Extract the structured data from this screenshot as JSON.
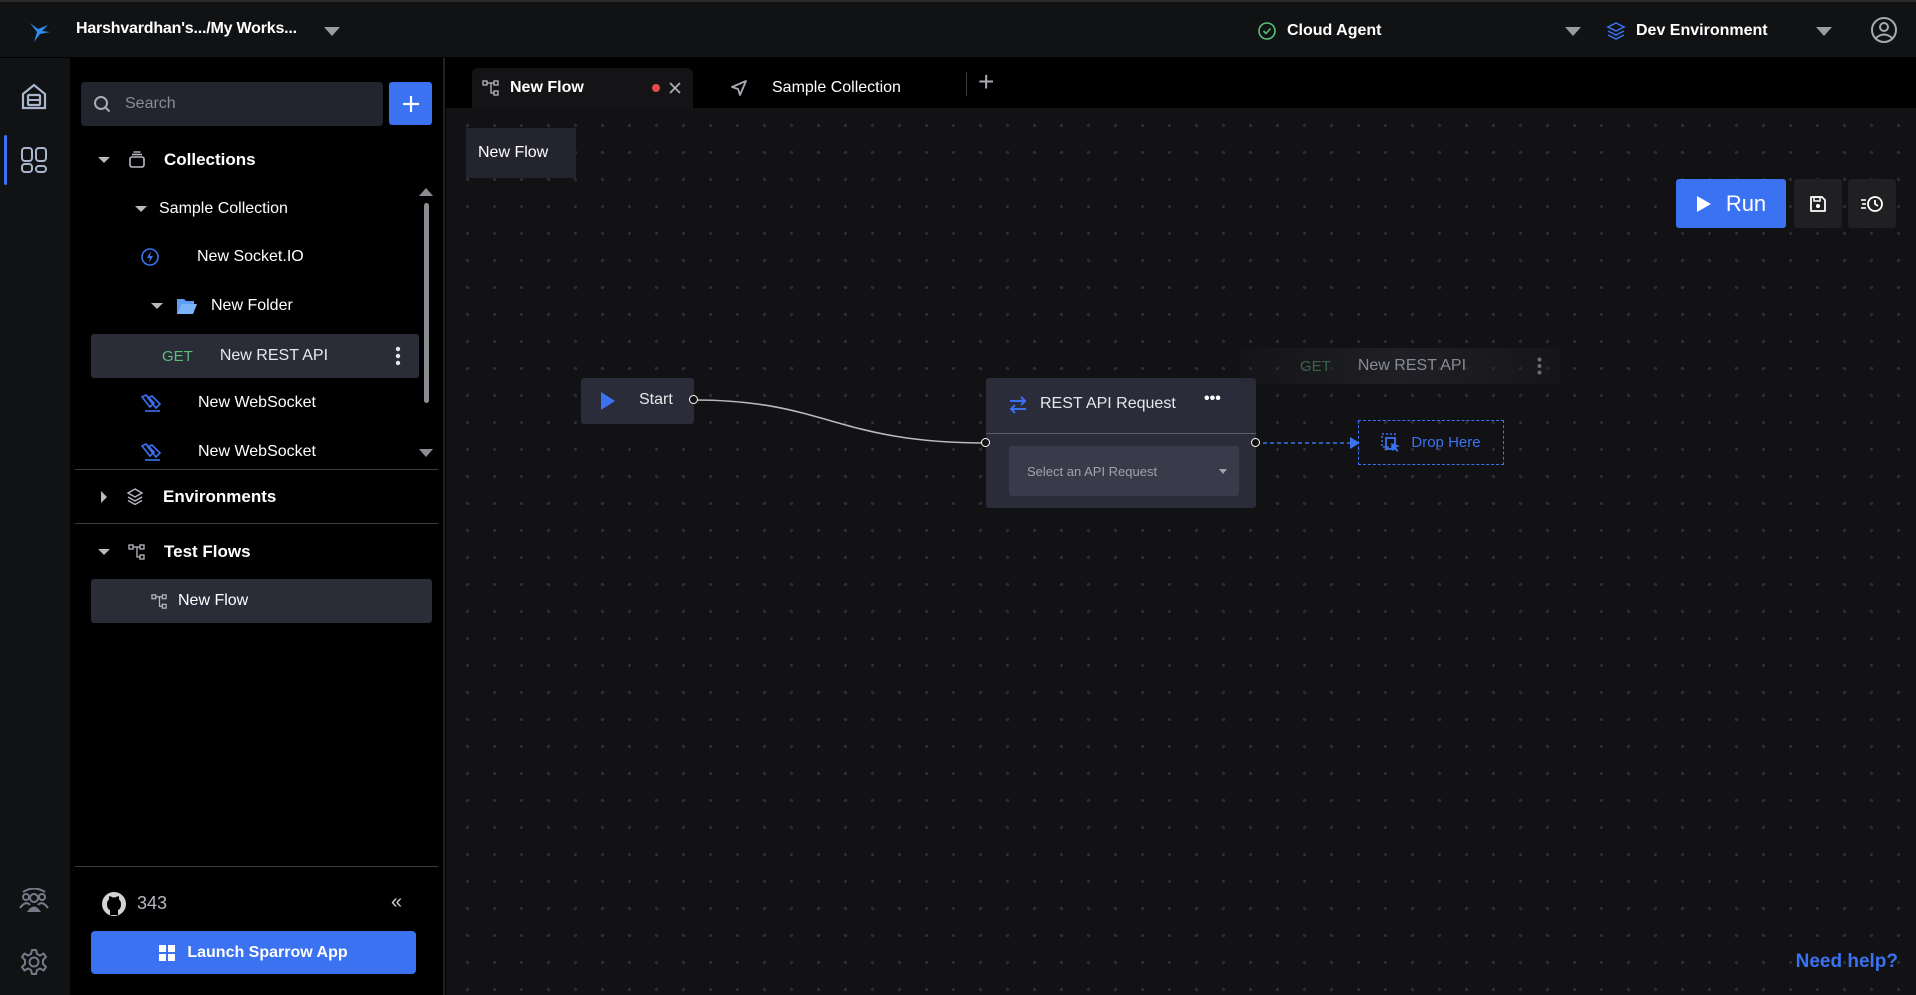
{
  "topbar": {
    "workspace": "Harshvardhan's.../My Works...",
    "agent": "Cloud Agent",
    "environment": "Dev Environment",
    "icons": {
      "logo": "sparrow-bird-icon",
      "agent": "check-circle-icon",
      "environment": "layers-icon",
      "profile": "user-circle-icon"
    }
  },
  "rail": {
    "items": [
      {
        "name": "home",
        "icon": "home-icon",
        "active": false
      },
      {
        "name": "collections",
        "icon": "grid-icon",
        "active": true
      },
      {
        "name": "team",
        "icon": "team-icon",
        "active": false
      },
      {
        "name": "settings",
        "icon": "gear-icon",
        "active": false
      }
    ]
  },
  "sidebar": {
    "search_placeholder": "Search",
    "add_label": "+",
    "collections_label": "Collections",
    "collection_tree": {
      "name": "Sample Collection",
      "items": [
        {
          "type": "socketio",
          "label": "New Socket.IO"
        },
        {
          "type": "folder",
          "label": "New Folder"
        },
        {
          "type": "rest",
          "method": "GET",
          "label": "New REST API",
          "selected": true
        },
        {
          "type": "websocket",
          "label": "New WebSocket"
        },
        {
          "type": "websocket",
          "label": "New WebSocket"
        }
      ]
    },
    "environments_label": "Environments",
    "testflows_label": "Test Flows",
    "testflows": [
      {
        "label": "New Flow",
        "selected": true
      }
    ],
    "github_stars": "343",
    "collapse_label": "«",
    "launch_label": "Launch Sparrow App"
  },
  "tabs": [
    {
      "label": "New Flow",
      "icon": "flow-icon",
      "active": true,
      "unsaved": true
    },
    {
      "label": "Sample Collection",
      "icon": "collection-icon",
      "active": false
    }
  ],
  "tab_add_label": "+",
  "canvas": {
    "flow_name": "New Flow",
    "run_label": "Run",
    "start_node_label": "Start",
    "rest_node": {
      "title": "REST API Request",
      "select_placeholder": "Select an API Request",
      "menu": "•••"
    },
    "drag_ghost": {
      "method": "GET",
      "label": "New REST API"
    },
    "drop_label": "Drop Here",
    "help_label": "Need help?"
  },
  "colors": {
    "accent": "#3b72f2",
    "get": "#5cbf7a",
    "unsaved": "#e04b4b",
    "agent_ok": "#5cbf7a"
  }
}
